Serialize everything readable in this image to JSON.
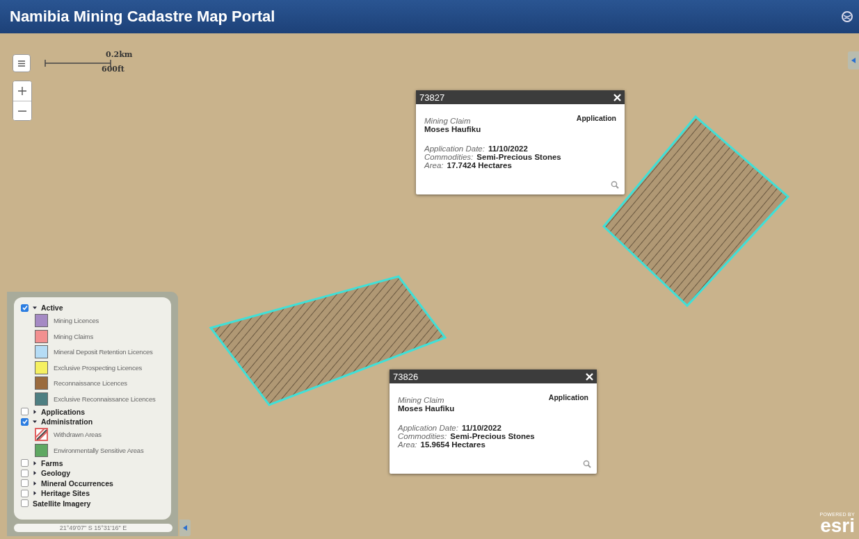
{
  "header": {
    "title": "Namibia Mining Cadastre Map Portal"
  },
  "scale_bar": {
    "metric": "0.2km",
    "imperial": "600ft"
  },
  "popups": [
    {
      "id": "73827",
      "type": "Mining Claim",
      "owner": "Moses Haufiku",
      "status": "Application",
      "fields": [
        {
          "label": "Application Date:",
          "value": "11/10/2022"
        },
        {
          "label": "Commodities:",
          "value": "Semi-Precious Stones"
        },
        {
          "label": "Area:",
          "value": "17.7424 Hectares"
        }
      ]
    },
    {
      "id": "73826",
      "type": "Mining Claim",
      "owner": "Moses Haufiku",
      "status": "Application",
      "fields": [
        {
          "label": "Application Date:",
          "value": "11/10/2022"
        },
        {
          "label": "Commodities:",
          "value": "Semi-Precious Stones"
        },
        {
          "label": "Area:",
          "value": "15.9654 Hectares"
        }
      ]
    }
  ],
  "legend": {
    "groups": [
      {
        "label": "Active",
        "checked": true,
        "expanded": true,
        "items": [
          {
            "label": "Mining Licences",
            "kind": "fill",
            "color": "#a58ac4"
          },
          {
            "label": "Mining Claims",
            "kind": "fill",
            "color": "#f29090"
          },
          {
            "label": "Mineral Deposit Retention Licences",
            "kind": "fill",
            "color": "#b5dcf5"
          },
          {
            "label": "Exclusive Prospecting Licences",
            "kind": "fill",
            "color": "#f5f060"
          },
          {
            "label": "Reconnaissance Licences",
            "kind": "fill",
            "color": "#9a6b3e"
          },
          {
            "label": "Exclusive Reconnaissance Licences",
            "kind": "fill",
            "color": "#4e7f82"
          }
        ]
      },
      {
        "label": "Applications",
        "checked": false,
        "expanded": false
      },
      {
        "label": "Administration",
        "checked": true,
        "expanded": true,
        "items": [
          {
            "label": "Withdrawn Areas",
            "kind": "hatched",
            "color": "#e06060"
          },
          {
            "label": "Environmentally Sensitive Areas",
            "kind": "fill",
            "color": "#5fa862"
          }
        ]
      },
      {
        "label": "Farms",
        "checked": false,
        "expanded": false
      },
      {
        "label": "Geology",
        "checked": false,
        "expanded": false
      },
      {
        "label": "Mineral Occurrences",
        "checked": false,
        "expanded": false
      },
      {
        "label": "Heritage Sites",
        "checked": false,
        "expanded": false
      },
      {
        "label": "Satellite Imagery",
        "checked": false
      }
    ]
  },
  "coordinates": "21°49'07\" S  15°31'16\" E",
  "attribution": {
    "caption": "POWERED BY",
    "logo": "esri"
  }
}
